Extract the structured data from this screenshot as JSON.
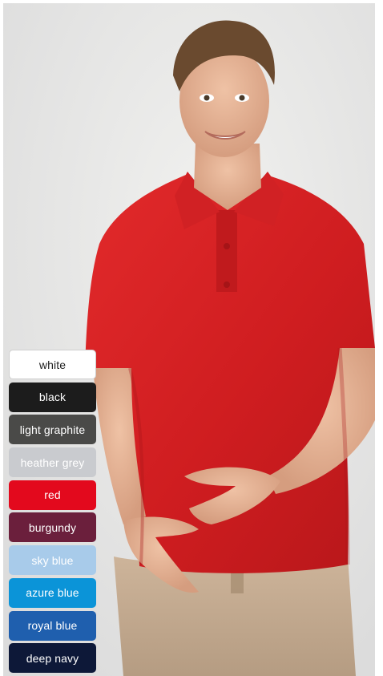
{
  "product": {
    "image_alt": "Man wearing red polo shirt"
  },
  "color_options": [
    {
      "label": "white",
      "bg": "#ffffff",
      "fg": "#222222"
    },
    {
      "label": "black",
      "bg": "#1c1c1c",
      "fg": "#ffffff"
    },
    {
      "label": "light graphite",
      "bg": "#4a4a48",
      "fg": "#ffffff"
    },
    {
      "label": "heather grey",
      "bg": "#c9cbcf",
      "fg": "#ffffff"
    },
    {
      "label": "red",
      "bg": "#e3091d",
      "fg": "#ffffff"
    },
    {
      "label": "burgundy",
      "bg": "#6b1f3c",
      "fg": "#ffffff"
    },
    {
      "label": "sky blue",
      "bg": "#a8cbea",
      "fg": "#ffffff"
    },
    {
      "label": "azure blue",
      "bg": "#0b94d8",
      "fg": "#ffffff"
    },
    {
      "label": "royal blue",
      "bg": "#1f5fae",
      "fg": "#ffffff"
    },
    {
      "label": "deep navy",
      "bg": "#0d1838",
      "fg": "#ffffff"
    }
  ]
}
